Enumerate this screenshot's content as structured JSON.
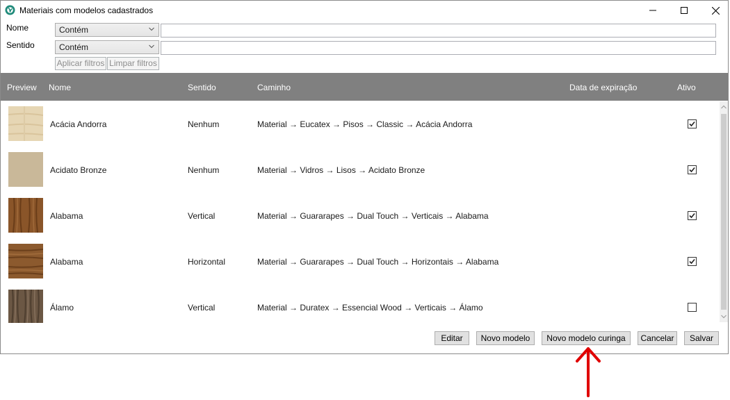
{
  "window": {
    "title": "Materiais com modelos cadastrados"
  },
  "filters": {
    "nome_label": "Nome",
    "sentido_label": "Sentido",
    "nome_mode": "Contém",
    "sentido_mode": "Contém",
    "nome_value": "",
    "sentido_value": "",
    "apply_label": "Aplicar filtros",
    "clear_label": "Limpar filtros"
  },
  "grid": {
    "columns": {
      "preview": "Preview",
      "nome": "Nome",
      "sentido": "Sentido",
      "caminho": "Caminho",
      "data_expiracao": "Data de expiração",
      "ativo": "Ativo"
    },
    "rows": [
      {
        "nome": "Acácia Andorra",
        "sentido": "Nenhum",
        "caminho": "Material → Eucatex → Pisos → Classic → Acácia Andorra",
        "ativo": true
      },
      {
        "nome": "Acidato Bronze",
        "sentido": "Nenhum",
        "caminho": "Material → Vidros → Lisos → Acidato Bronze",
        "ativo": true
      },
      {
        "nome": "Alabama",
        "sentido": "Vertical",
        "caminho": "Material → Guararapes → Dual Touch → Verticais → Alabama",
        "ativo": true
      },
      {
        "nome": "Alabama",
        "sentido": "Horizontal",
        "caminho": "Material → Guararapes → Dual Touch → Horizontais → Alabama",
        "ativo": true
      },
      {
        "nome": "Álamo",
        "sentido": "Vertical",
        "caminho": "Material → Duratex → Essencial Wood → Verticais → Álamo",
        "ativo": false
      }
    ]
  },
  "buttons": {
    "editar": "Editar",
    "novo_modelo": "Novo modelo",
    "novo_modelo_curinga": "Novo modelo curinga",
    "cancelar": "Cancelar",
    "salvar": "Salvar"
  },
  "colors": {
    "header_bg": "#808080",
    "annotation_arrow": "#e00000"
  },
  "icons": {
    "app": "app-logo-icon",
    "minimize": "minimize-icon",
    "maximize": "maximize-icon",
    "close": "close-icon",
    "annotation": "red-arrow-up-icon"
  }
}
